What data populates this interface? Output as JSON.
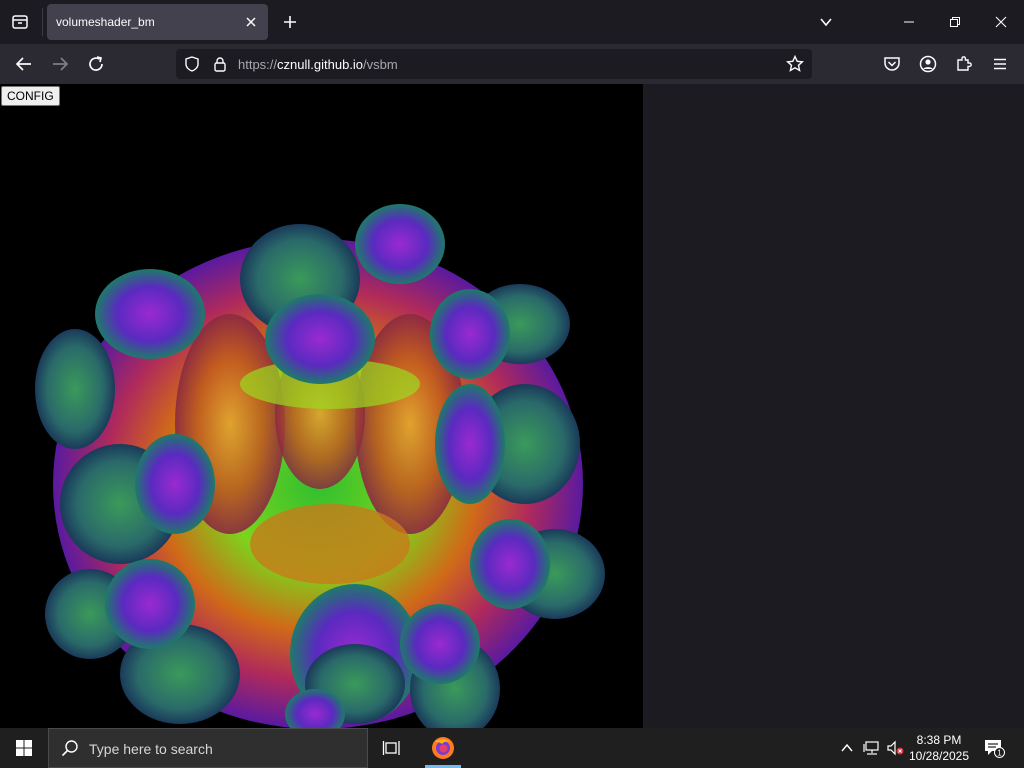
{
  "browser": {
    "tab_title": "volumeshader_bm",
    "url_prefix": "https://",
    "url_host": "cznull.github.io",
    "url_path": "/vsbm"
  },
  "page": {
    "config_label": "CONFIG"
  },
  "taskbar": {
    "search_placeholder": "Type here to search",
    "time": "8:38 PM",
    "date": "10/28/2025",
    "notification_count": "1"
  },
  "icons": {
    "all_tabs": "tab-list-icon",
    "close_tab": "close-icon",
    "new_tab": "plus-icon",
    "list_all_tabs": "chevron-down-icon",
    "minimize": "minimize-icon",
    "restore": "restore-icon",
    "close_window": "close-icon",
    "back": "back-arrow-icon",
    "forward": "forward-arrow-icon",
    "reload": "reload-icon",
    "tracking": "shield-icon",
    "secure": "lock-icon",
    "bookmark": "star-icon",
    "pocket": "pocket-icon",
    "account": "account-icon",
    "extensions": "puzzle-icon",
    "menu": "hamburger-icon",
    "start": "windows-logo-icon",
    "search": "search-icon",
    "task_view": "task-view-icon",
    "firefox": "firefox-icon",
    "tray_overflow": "chevron-up-icon",
    "network": "network-icon",
    "volume": "volume-muted-icon",
    "notifications": "notification-icon"
  },
  "colors": {
    "tab_bg": "#42414d",
    "nav_bg": "#2b2a33",
    "window_bg": "#1c1b22",
    "taskbar_bg": "#1f1f1f",
    "accent": "#76b9ed"
  }
}
